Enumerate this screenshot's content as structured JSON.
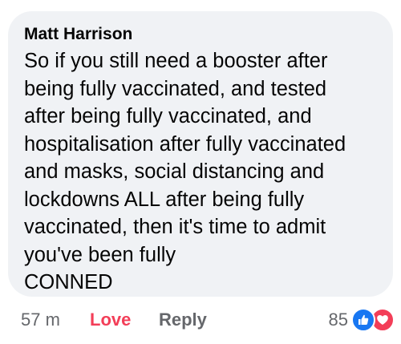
{
  "comment": {
    "author": "Matt Harrison",
    "text": "So if you still need a booster after\nbeing fully vaccinated, and tested\nafter being fully vaccinated, and\nhospitalisation after fully vaccinated\nand masks, social distancing and\nlockdowns ALL after being fully\nvaccinated, then it's time to admit\nyou've been fully\nCONNED"
  },
  "actions": {
    "time": "57 m",
    "love_label": "Love",
    "reply_label": "Reply"
  },
  "reactions": {
    "count": "85",
    "icons": [
      "like-icon",
      "heart-icon"
    ]
  },
  "colors": {
    "bubble": "#f0f2f5",
    "love": "#f33e58",
    "like": "#1877f2",
    "muted": "#65676b"
  }
}
